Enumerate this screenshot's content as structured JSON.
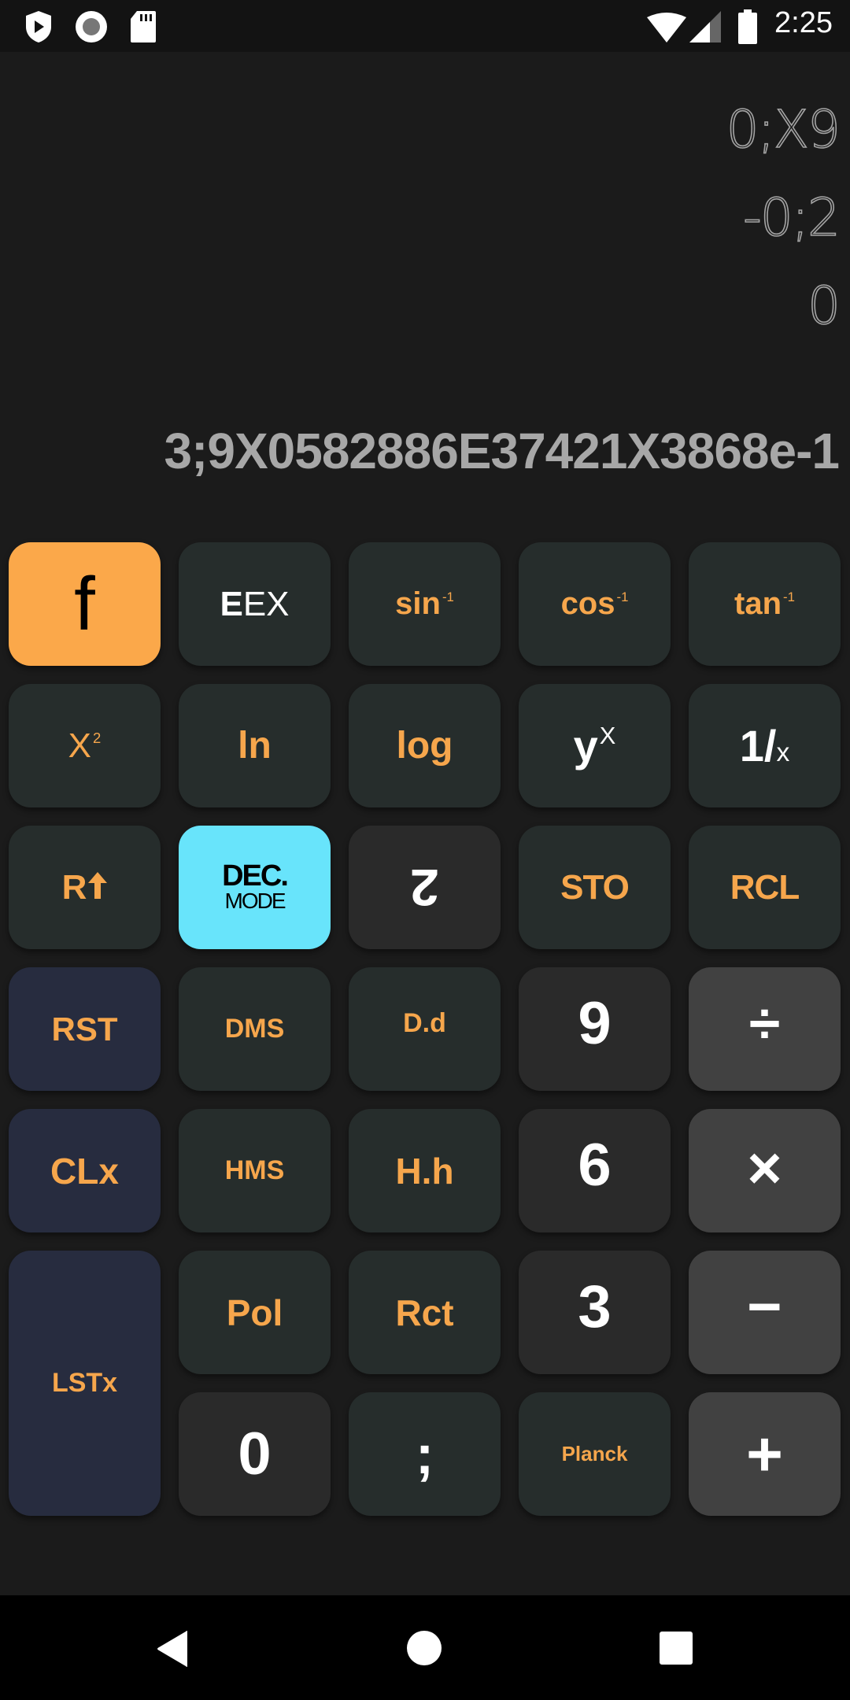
{
  "status_bar": {
    "time": "2:25",
    "left_icons": [
      "shield-play-icon",
      "record-icon",
      "sd-card-icon"
    ],
    "right_icons": [
      "wifi-icon",
      "cell-signal-icon",
      "battery-icon"
    ]
  },
  "display": {
    "stack": {
      "t": "0;X9",
      "z": "-0;2",
      "y": "0"
    },
    "x": "3;9X0582886E37421X3868e-1"
  },
  "keys": {
    "f": "f",
    "eex_bold": "E",
    "eex_rest": "EX",
    "asin": "sin",
    "acos": "cos",
    "atan": "tan",
    "inv_sup": "-1",
    "x2_base": "X",
    "x2_sup": "2",
    "ln": "ln",
    "log": "log",
    "yx_base": "y",
    "yx_sup": "X",
    "recip_one": "1/",
    "recip_x": "x",
    "r_up": "R",
    "r_up_arrow": "🠅",
    "mode_top": "DEC.",
    "mode_bottom": "MODE",
    "digit_dek": "ƨ",
    "sto": "STO",
    "rcl": "RCL",
    "rst": "RST",
    "dms": "DMS",
    "dd": "D.d",
    "nine": "9",
    "divide": "÷",
    "clx": "CLx",
    "hms": "HMS",
    "hh": "H.h",
    "six": "6",
    "multiply": "×",
    "lstx": "LSTx",
    "pol": "Pol",
    "rct": "Rct",
    "three": "3",
    "minus": "−",
    "zero": "0",
    "semicolon": ";",
    "planck": "Planck",
    "plus": "+"
  },
  "nav_bar": {
    "icons": [
      "back-icon",
      "home-icon",
      "recents-icon"
    ]
  },
  "colors": {
    "accent_orange": "#fba84a",
    "label_orange": "#f6a64c",
    "mode_cyan": "#68e4fb",
    "key_dark_green": "#262d2c",
    "key_num": "#2a2a2a",
    "key_op": "#414141",
    "key_blue": "#272c3f",
    "background": "#1b1b1b"
  }
}
